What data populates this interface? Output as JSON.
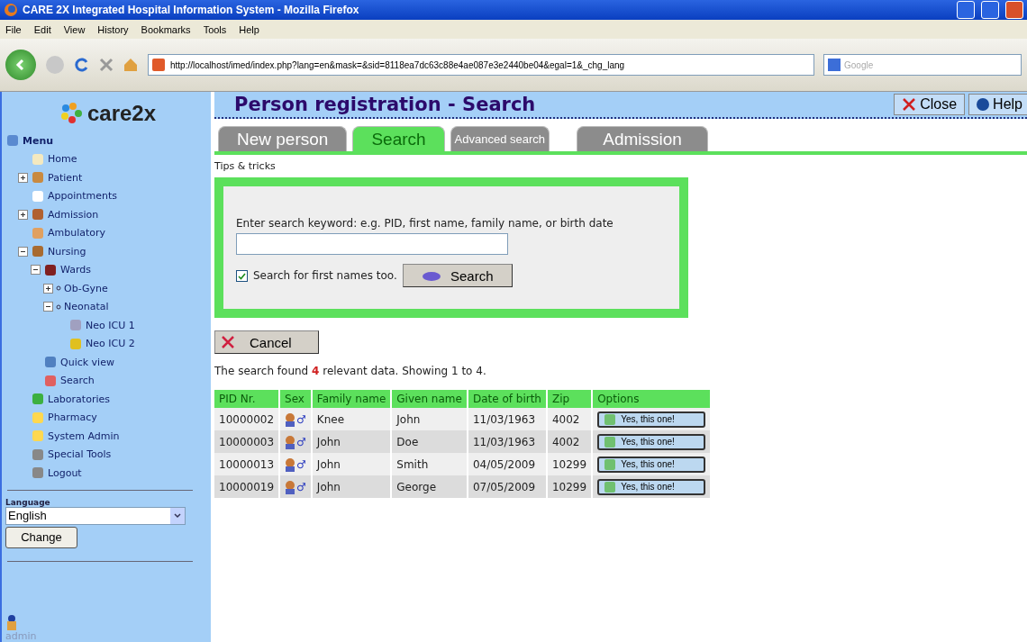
{
  "window": {
    "title": "CARE 2X Integrated Hospital Information System - Mozilla Firefox"
  },
  "menubar": [
    "File",
    "Edit",
    "View",
    "History",
    "Bookmarks",
    "Tools",
    "Help"
  ],
  "navbar": {
    "url": "http://localhost/imed/index.php?lang=en&mask=&sid=8118ea7dc63c88e4ae087e3e2440be04&egal=1&_chg_lang",
    "search_placeholder": "Google"
  },
  "sidebar": {
    "logo": "care2x",
    "menu_title": "Menu",
    "items": [
      {
        "label": "Home"
      },
      {
        "label": "Patient",
        "expanded": false
      },
      {
        "label": "Appointments"
      },
      {
        "label": "Admission",
        "expanded": false
      },
      {
        "label": "Ambulatory"
      },
      {
        "label": "Nursing",
        "expanded": true,
        "children": [
          {
            "label": "Wards",
            "expanded": true,
            "children": [
              {
                "label": "Ob-Gyne",
                "expanded": false
              },
              {
                "label": "Neonatal",
                "expanded": true,
                "children": [
                  {
                    "label": "Neo ICU 1"
                  },
                  {
                    "label": "Neo ICU 2"
                  }
                ]
              }
            ]
          },
          {
            "label": "Quick view"
          },
          {
            "label": "Search"
          }
        ]
      },
      {
        "label": "Laboratories"
      },
      {
        "label": "Pharmacy"
      },
      {
        "label": "System Admin"
      },
      {
        "label": "Special Tools"
      },
      {
        "label": "Logout"
      }
    ],
    "language_label": "Language",
    "language_value": "English",
    "change_button": "Change",
    "user": "admin"
  },
  "header": {
    "title": "Person registration - Search",
    "close": "Close",
    "help": "Help"
  },
  "tabs": [
    {
      "label": "New person",
      "selected": false
    },
    {
      "label": "Search",
      "selected": true
    },
    {
      "label": "Advanced search",
      "selected": false
    },
    {
      "label": "Admission",
      "selected": false
    }
  ],
  "tips": "Tips & tricks",
  "search": {
    "prompt": "Enter search keyword: e.g. PID, first name, family name, or birth date",
    "first_names_label": "Search for first names too.",
    "first_names_checked": true,
    "button": "Search"
  },
  "cancel": "Cancel",
  "result_text": "The search found **4** relevant data. Showing 1 to 4.",
  "table": {
    "columns": [
      "PID Nr.",
      "Sex",
      "Family name",
      "Given name",
      "Date of birth",
      "Zip",
      "Options"
    ],
    "rows": [
      {
        "pid": "10000002",
        "sex": "♂",
        "family": "Knee",
        "given": "John",
        "dob": "11/03/1963",
        "zip": "4002",
        "option": "Yes, this one!"
      },
      {
        "pid": "10000003",
        "sex": "♂",
        "family": "John",
        "given": "Doe",
        "dob": "11/03/1963",
        "zip": "4002",
        "option": "Yes, this one!"
      },
      {
        "pid": "10000013",
        "sex": "♂",
        "family": "John",
        "given": "Smith",
        "dob": "04/05/2009",
        "zip": "10299",
        "option": "Yes, this one!"
      },
      {
        "pid": "10000019",
        "sex": "♂",
        "family": "John",
        "given": "George",
        "dob": "07/05/2009",
        "zip": "10299",
        "option": "Yes, this one!"
      }
    ]
  }
}
